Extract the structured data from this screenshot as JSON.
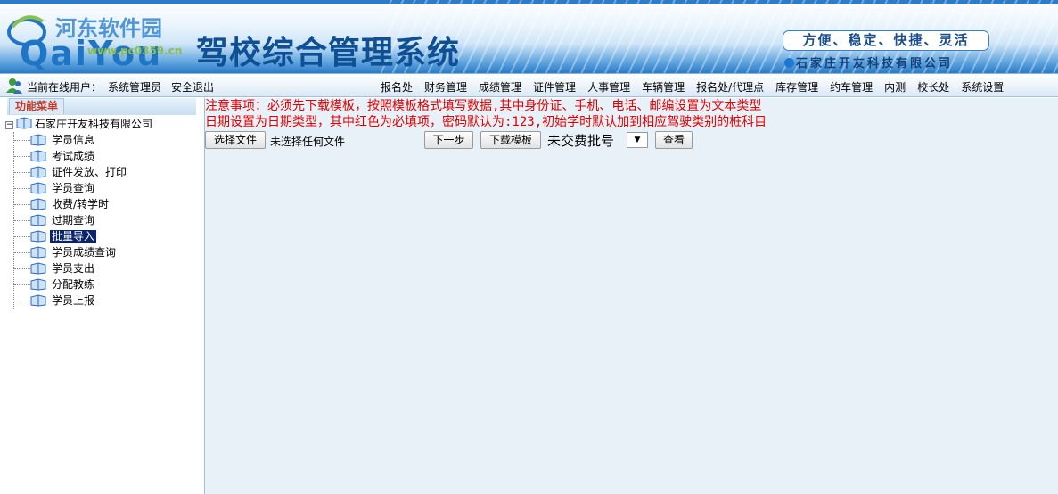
{
  "header": {
    "logo_text": "QaiYou",
    "watermark_title": "河东软件园",
    "watermark_url": "www.pc0359.cn",
    "app_title": "驾校综合管理系统",
    "slogan": "方便、稳定、快捷、灵活",
    "company": "石家庄开友科技有限公司"
  },
  "navbar": {
    "online_label": "当前在线用户：",
    "user_name": "系统管理员",
    "logout": "安全退出",
    "menu": [
      "报名处",
      "财务管理",
      "成绩管理",
      "证件管理",
      "人事管理",
      "车辆管理",
      "报名处/代理点",
      "库存管理",
      "约车管理",
      "内测",
      "校长处",
      "系统设置"
    ]
  },
  "sidebar": {
    "tab_label": "功能菜单",
    "root": "石家庄开友科技有限公司",
    "items": [
      "学员信息",
      "考试成绩",
      "证件发放、打印",
      "学员查询",
      "收费/转学时",
      "过期查询",
      "批量导入",
      "学员成绩查询",
      "学员支出",
      "分配教练",
      "学员上报"
    ],
    "selected_index": 6
  },
  "main": {
    "notice_line1": "注意事项：必须先下载模板，按照模板格式填写数据,其中身份证、手机、电话、邮编设置为文本类型",
    "notice_line2": "日期设置为日期类型，其中红色为必填项，密码默认为:123,初始学时默认加到相应驾驶类别的桩科目",
    "choose_file_btn": "选择文件",
    "file_status": "未选择任何文件",
    "next_btn": "下一步",
    "download_btn": "下载模板",
    "unpaid_label": "未交费批号",
    "select_arrow": "▼",
    "view_btn": "查看"
  },
  "colors": {
    "notice": "#e00000",
    "selected_bg": "#0a246a",
    "main_bg": "#e8f1f8",
    "title": "#0f4f93"
  }
}
